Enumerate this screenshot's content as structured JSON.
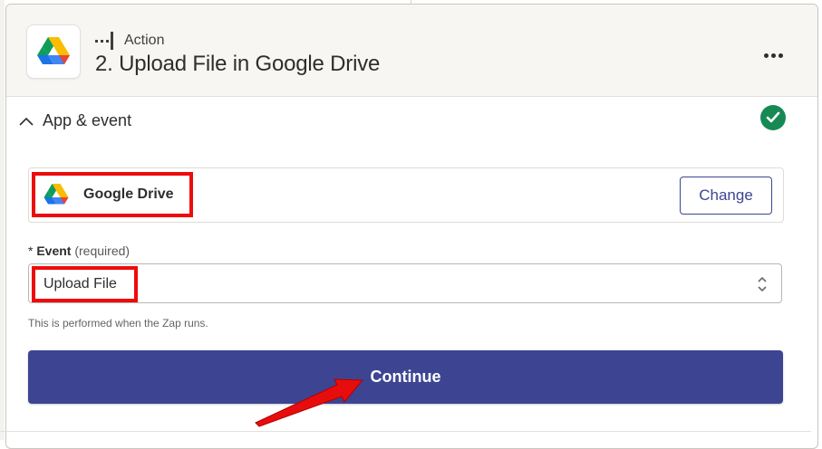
{
  "header": {
    "step_type": "Action",
    "step_title": "2. Upload File in Google Drive",
    "more_icon": "more-horizontal-icon"
  },
  "section": {
    "title": "App & event",
    "status_icon": "check-circle-icon",
    "status_color": "#178a54"
  },
  "app": {
    "name": "Google Drive",
    "change_label": "Change"
  },
  "event": {
    "asterisk": "*",
    "label": "Event",
    "required_text": "(required)",
    "value": "Upload File",
    "helper": "This is performed when the Zap runs."
  },
  "actions": {
    "continue_label": "Continue"
  },
  "colors": {
    "primary": "#3d4592",
    "highlight": "#ee0b0b",
    "success": "#178a54"
  }
}
